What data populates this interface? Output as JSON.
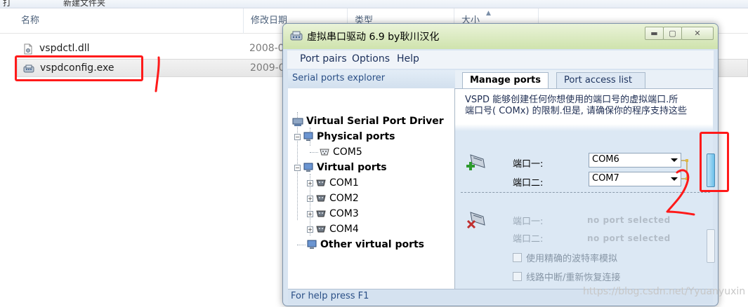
{
  "explorer": {
    "top_items": [
      "打",
      "新建文件夹"
    ],
    "columns": {
      "name": "名称",
      "modified": "修改日期",
      "type": "类型",
      "size": "大小"
    },
    "files": [
      {
        "name": "vspdctl.dll",
        "date": "2008-0"
      },
      {
        "name": "vspdconfig.exe",
        "date": "2009-0"
      }
    ]
  },
  "dialog": {
    "title": "虚拟串口驱动 6.9 by耿川汉化",
    "menu": [
      "Port pairs",
      "Options",
      "Help"
    ],
    "explorer_header": "Serial ports explorer",
    "tree": {
      "root": "Virtual Serial Port Driver",
      "physical": "Physical ports",
      "physical_items": [
        "COM5"
      ],
      "virtual": "Virtual ports",
      "virtual_items": [
        "COM1",
        "COM2",
        "COM3",
        "COM4"
      ],
      "other": "Other virtual ports"
    },
    "tabs": [
      "Manage ports",
      "Port access list"
    ],
    "description_line1": "VSPD 能够创建任何你想使用的端口号的虚拟端口.所",
    "description_line2": "端口号( COMx) 的限制.但是, 请确保你的程序支持这些",
    "pair": {
      "port1_label": "端口一:",
      "port1_value": "COM6",
      "port2_label": "端口二:",
      "port2_value": "COM7"
    },
    "existing": {
      "port1_label": "端口一:",
      "port1_value": "no port selected",
      "port2_label": "端口二:",
      "port2_value": "no port selected"
    },
    "checkboxes": [
      "使用精确的波特率模拟",
      "线路中断/重新恢复连接"
    ],
    "status": "For help press F1"
  },
  "annotations": {
    "mark1": "1",
    "mark2": "2"
  },
  "watermark": "https://blog.csdn.net/Yyuanyuxin"
}
